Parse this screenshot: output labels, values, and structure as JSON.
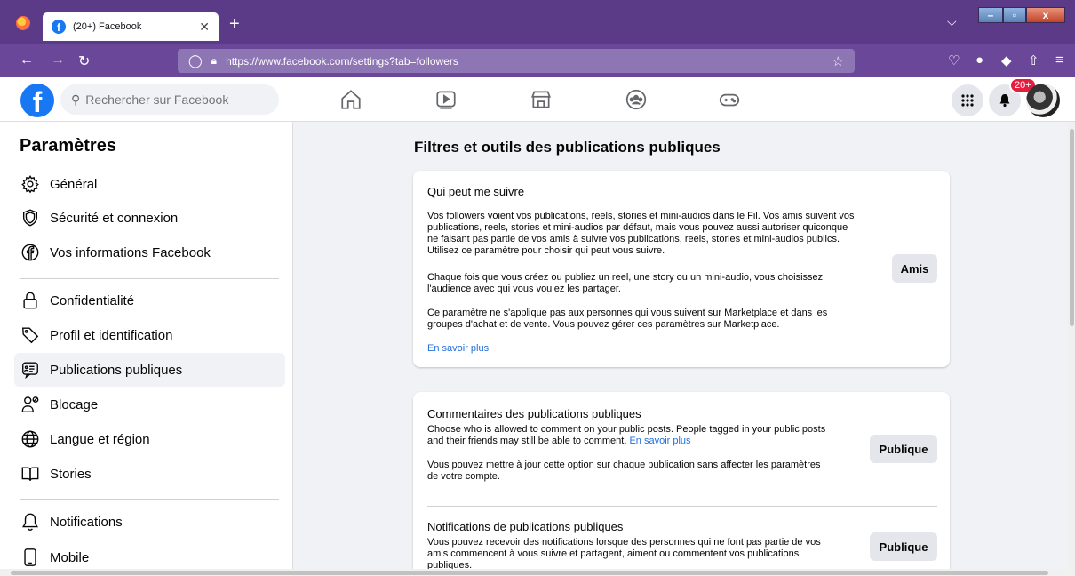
{
  "browser": {
    "tab_title": "(20+) Facebook",
    "url": "https://www.facebook.com/settings?tab=followers"
  },
  "fb": {
    "search_placeholder": "Rechercher sur Facebook",
    "badge": "20+"
  },
  "sidebar": {
    "title": "Paramètres",
    "items": [
      {
        "label": "Général",
        "icon": "gear-icon"
      },
      {
        "label": "Sécurité et connexion",
        "icon": "shield-icon"
      },
      {
        "label": "Vos informations Facebook",
        "icon": "facebook-icon"
      },
      {
        "label": "Confidentialité",
        "icon": "lock-icon"
      },
      {
        "label": "Profil et identification",
        "icon": "tag-icon"
      },
      {
        "label": "Publications publiques",
        "icon": "public-posts-icon",
        "active": true
      },
      {
        "label": "Blocage",
        "icon": "block-user-icon"
      },
      {
        "label": "Langue et région",
        "icon": "globe-icon"
      },
      {
        "label": "Stories",
        "icon": "book-icon"
      },
      {
        "label": "Notifications",
        "icon": "bell-icon"
      },
      {
        "label": "Mobile",
        "icon": "mobile-icon"
      }
    ]
  },
  "main": {
    "title": "Filtres et outils des publications publiques",
    "followers": {
      "title": "Qui peut me suivre",
      "p1": [
        "Vos followers voient vos publications, reels, stories et mini-audios dans le Fil. Vos amis suivent vos",
        "publications, reels, stories et mini-audios par défaut, mais vous pouvez aussi autoriser quiconque",
        "ne faisant pas partie de vos amis à suivre vos publications, reels, stories et mini-audios publics.",
        "Utilisez ce paramètre pour choisir qui peut vous suivre."
      ],
      "p2": [
        "Chaque fois que vous créez ou publiez un reel, une story ou un mini-audio, vous choisissez",
        "l'audience avec qui vous voulez les partager."
      ],
      "p3": [
        "Ce paramètre ne s'applique pas aux personnes qui vous suivent sur Marketplace et dans les",
        "groupes d'achat et de vente. Vous pouvez gérer ces paramètres sur Marketplace."
      ],
      "link": "En savoir plus",
      "button": "Amis"
    },
    "comments": {
      "title": "Commentaires des publications publiques",
      "p1a": "Choose who is allowed to comment on your public posts. People tagged in your public posts",
      "p1b": "and their friends may still be able to comment.",
      "link": "En savoir plus",
      "p2": [
        "Vous pouvez mettre à jour cette option sur chaque publication sans affecter les paramètres",
        "de votre compte."
      ],
      "button": "Publique"
    },
    "notifications": {
      "title": "Notifications de publications publiques",
      "p1": [
        "Vous pouvez recevoir des notifications lorsque des personnes qui ne font pas partie de vos",
        "amis commencent à vous suivre et partagent, aiment ou commentent vos publications",
        "publiques."
      ],
      "button": "Publique"
    }
  }
}
